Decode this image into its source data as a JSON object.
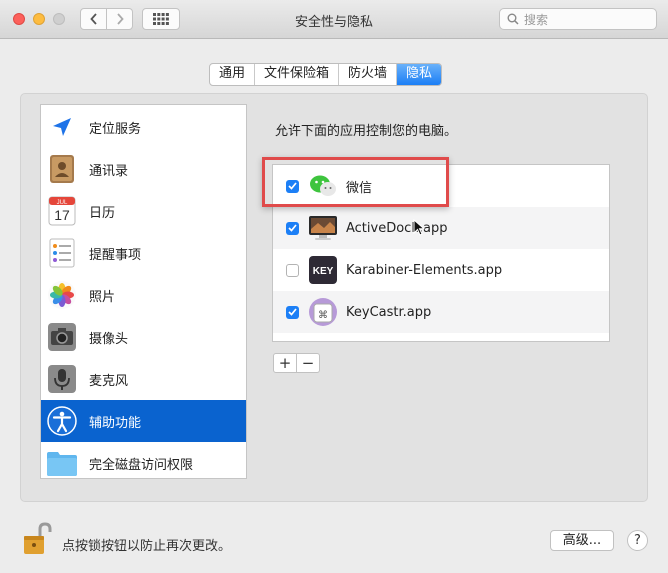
{
  "window": {
    "title": "安全性与隐私"
  },
  "toolbar": {
    "search_placeholder": "搜索"
  },
  "tabs": [
    {
      "label": "通用",
      "active": false
    },
    {
      "label": "文件保险箱",
      "active": false
    },
    {
      "label": "防火墙",
      "active": false
    },
    {
      "label": "隐私",
      "active": true
    }
  ],
  "sidebar": {
    "items": [
      {
        "label": "定位服务",
        "icon": "location-arrow-icon"
      },
      {
        "label": "通讯录",
        "icon": "contacts-book-icon"
      },
      {
        "label": "日历",
        "icon": "calendar-icon",
        "day": "17",
        "month": "JUL"
      },
      {
        "label": "提醒事项",
        "icon": "reminders-icon"
      },
      {
        "label": "照片",
        "icon": "photos-icon"
      },
      {
        "label": "摄像头",
        "icon": "camera-icon"
      },
      {
        "label": "麦克风",
        "icon": "microphone-icon"
      },
      {
        "label": "辅助功能",
        "icon": "accessibility-icon",
        "selected": true
      },
      {
        "label": "完全磁盘访问权限",
        "icon": "folder-icon"
      }
    ]
  },
  "main": {
    "prompt": "允许下面的应用控制您的电脑。",
    "apps": [
      {
        "name": "微信",
        "checked": true,
        "icon": "wechat-icon"
      },
      {
        "name": "ActiveDock.app",
        "checked": true,
        "icon": "activedock-icon"
      },
      {
        "name": "Karabiner-Elements.app",
        "checked": false,
        "icon": "karabiner-icon",
        "icon_text": "KEY"
      },
      {
        "name": "KeyCastr.app",
        "checked": true,
        "icon": "keycastr-icon",
        "icon_text": "⌘"
      }
    ],
    "add_label": "+",
    "remove_label": "−"
  },
  "footer": {
    "lock_text": "点按锁按钮以防止再次更改。",
    "advanced_label": "高级...",
    "help_label": "?"
  },
  "colors": {
    "accent": "#1c7ff6",
    "selection": "#0a63cf",
    "highlight_box": "#e04b4b"
  }
}
